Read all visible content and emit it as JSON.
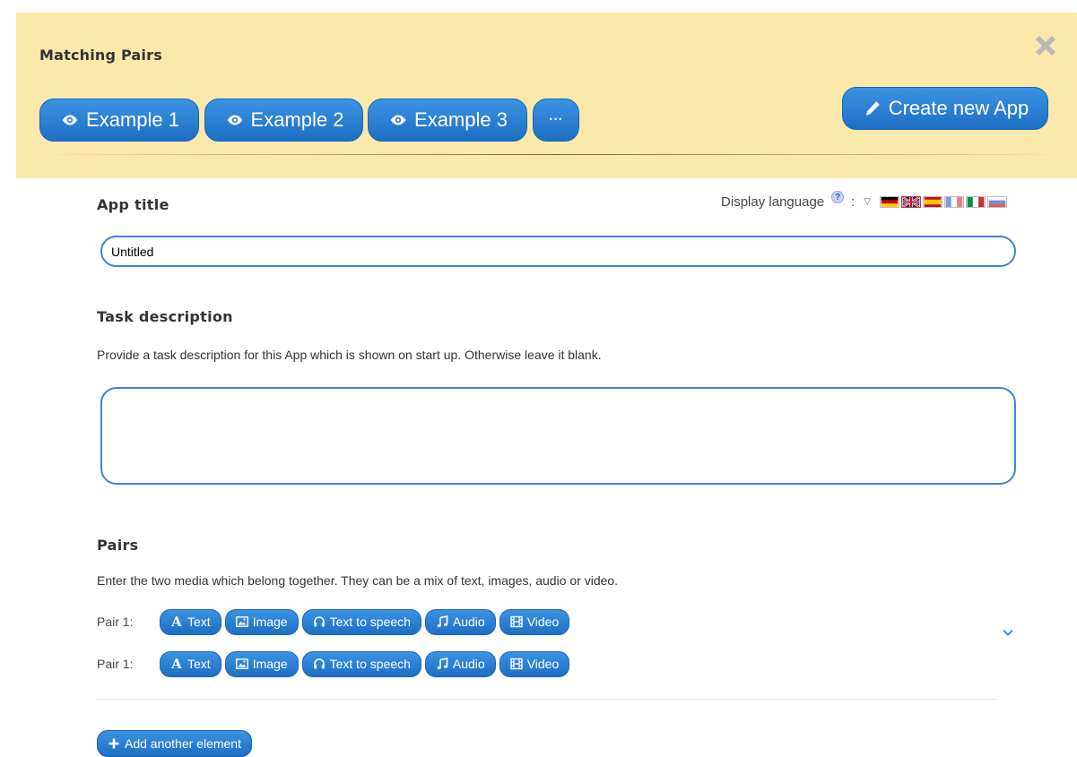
{
  "header": {
    "title": "Matching Pairs",
    "examples": [
      {
        "label": "Example 1"
      },
      {
        "label": "Example 2"
      },
      {
        "label": "Example 3"
      }
    ],
    "more_label": "···",
    "create_label": "Create new App",
    "close_icon": "close-x-icon"
  },
  "app_title": {
    "heading": "App title",
    "value": "Untitled"
  },
  "language": {
    "label": "Display language",
    "help": "?",
    "colon": ":",
    "dropdown": "▽",
    "flags": [
      {
        "name": "german-flag-icon"
      },
      {
        "name": "uk-flag-icon"
      },
      {
        "name": "spanish-flag-icon"
      },
      {
        "name": "french-flag-icon"
      },
      {
        "name": "italian-flag-icon"
      },
      {
        "name": "russian-flag-icon"
      }
    ]
  },
  "task": {
    "heading": "Task description",
    "description": "Provide a task description for this App which is shown on start up. Otherwise leave it blank.",
    "value": ""
  },
  "pairs": {
    "heading": "Pairs",
    "description": "Enter the two media which belong together. They can be a mix of text, images, audio or video.",
    "rows": [
      {
        "label": "Pair 1:"
      },
      {
        "label": "Pair 1:"
      }
    ],
    "buttons": {
      "text": "Text",
      "text_icon": "A",
      "image": "Image",
      "tts": "Text to speech",
      "audio": "Audio",
      "video": "Video"
    },
    "add_label": "Add another element"
  },
  "colors": {
    "header_bg": "#fbe8ab",
    "button_blue": "#2a7fd4",
    "input_border": "#3b86d2"
  }
}
